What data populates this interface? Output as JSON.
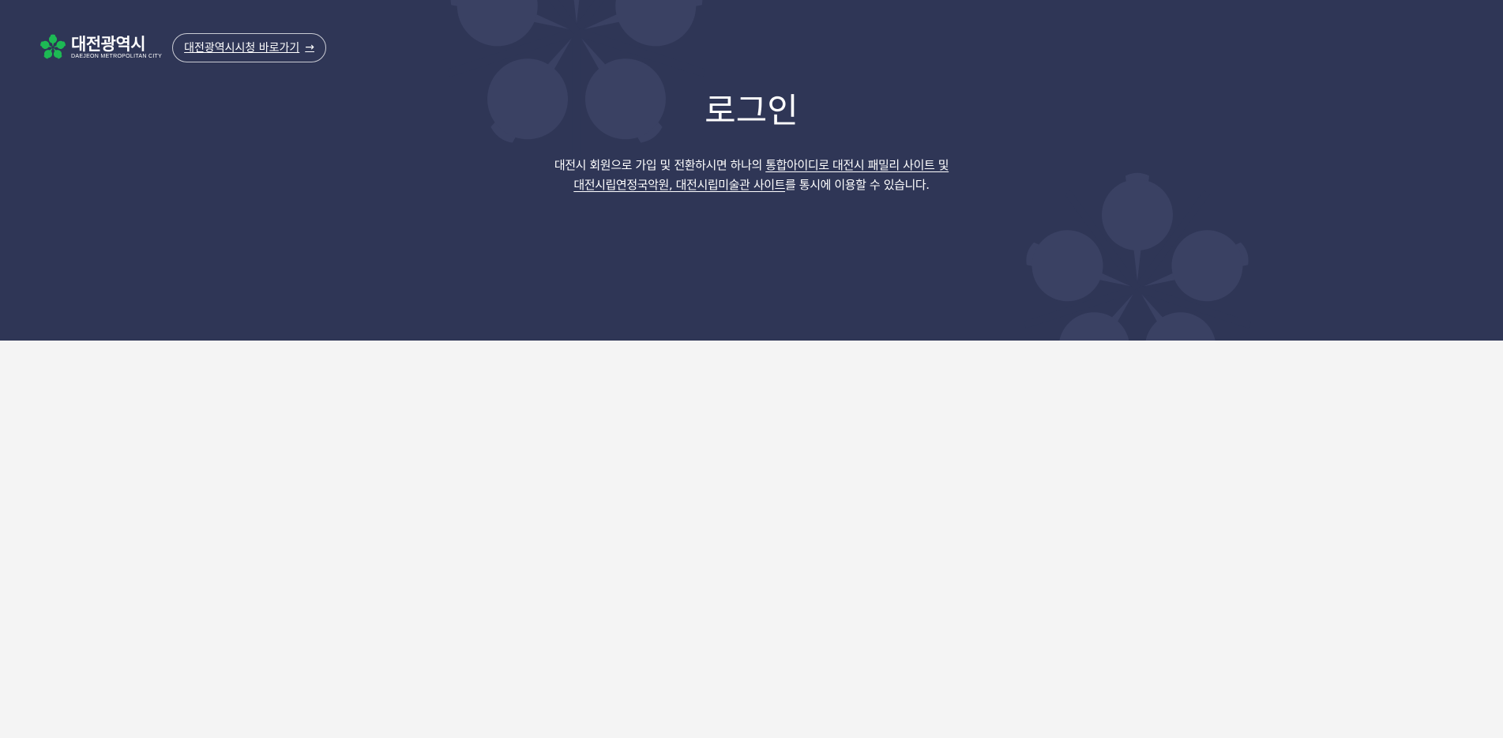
{
  "header": {
    "logo": {
      "name_ko": "대전광역시",
      "name_en": "DAEJEON METROPOLITAN CITY"
    },
    "shortcut_button": {
      "label": "대전광역시시청 바로가기",
      "icon": "arrow-right-icon"
    }
  },
  "main": {
    "title": "로그인",
    "description": {
      "line1_plain": "대전시 회원으로 가입 및 전환하시면 하나의 ",
      "line1_link": "통합아이디로 대전시 패밀리 사이트 및",
      "line2_link": "대전시립연정국악원, 대전시립미술관 사이트",
      "line2_plain": "를 통시에 이용할 수 있습니다."
    }
  },
  "colors": {
    "hero_background": "#2f3656",
    "page_background": "#f4f4f4",
    "logo_green": "#1db954",
    "text": "#ffffff"
  }
}
